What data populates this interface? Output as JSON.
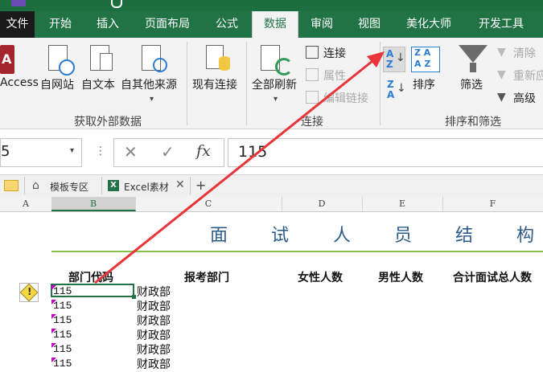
{
  "ribbon_tabs": [
    {
      "label": "文件"
    },
    {
      "label": "开始"
    },
    {
      "label": "插入"
    },
    {
      "label": "页面布局"
    },
    {
      "label": "公式"
    },
    {
      "label": "数据"
    },
    {
      "label": "审阅"
    },
    {
      "label": "视图"
    },
    {
      "label": "美化大师"
    },
    {
      "label": "开发工具"
    }
  ],
  "active_tab": "数据",
  "ribbon": {
    "get_external": {
      "access": "Access",
      "web": "自网站",
      "text": "自文本",
      "other": "自其他来源",
      "existing": "现有连接",
      "group": "获取外部数据"
    },
    "connections": {
      "refresh_all": "全部刷新",
      "connections": "连接",
      "properties": "属性",
      "edit_links": "编辑链接",
      "group": "连接"
    },
    "sort_filter": {
      "sort": "排序",
      "filter": "筛选",
      "clear": "清除",
      "reapply": "重新应",
      "advanced": "高级",
      "group": "排序和筛选"
    }
  },
  "formula_bar": {
    "name_box": "5",
    "cancel": "✕",
    "enter": "✓",
    "fx": "fx",
    "value": "115"
  },
  "sheet_tabs": [
    {
      "label": "模板专区"
    },
    {
      "label": "Excel素材"
    }
  ],
  "add_tab": "+",
  "columns": [
    "A",
    "B",
    "C",
    "D",
    "E",
    "F"
  ],
  "sheet_title_chars": [
    "面",
    "试",
    "人",
    "员",
    "结",
    "构"
  ],
  "table_headers": {
    "dept_code": "部门代码",
    "dept": "报考部门",
    "female": "女性人数",
    "male": "男性人数",
    "total": "合计面试总人数"
  },
  "rows": [
    {
      "code": "115",
      "dept": "财政部"
    },
    {
      "code": "115",
      "dept": "财政部"
    },
    {
      "code": "115",
      "dept": "财政部"
    },
    {
      "code": "115",
      "dept": "财政部"
    },
    {
      "code": "115",
      "dept": "财政部"
    },
    {
      "code": "115",
      "dept": "财政部"
    }
  ],
  "colors": {
    "excel_green": "#217346",
    "arrow_red": "#e8343a",
    "title_blue": "#2e5c8a",
    "error_triangle": "#c000c0",
    "warning_yellow": "#f5d742"
  }
}
